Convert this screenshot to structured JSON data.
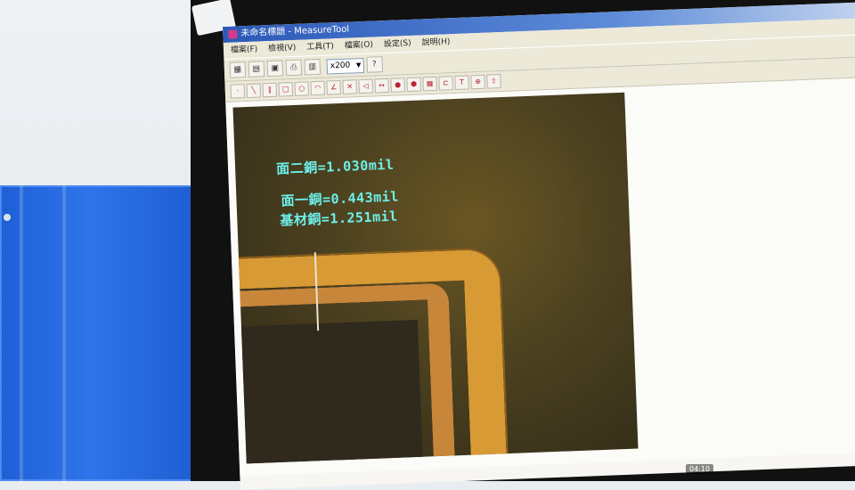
{
  "window": {
    "title": "未命名標題 - MeasureTool"
  },
  "menu": [
    "檔案(F)",
    "檢視(V)",
    "工具(T)",
    "檔案(O)",
    "設定(S)",
    "說明(H)"
  ],
  "toolbar": {
    "zoom": "x200"
  },
  "measurements": [
    "面二銅=1.030mil",
    "面一銅=0.443mil",
    "基材銅=1.251mil"
  ],
  "overlay": {
    "timestamp": "04:10"
  },
  "colors": {
    "label": "#6df0ea",
    "copper": "#d89a34"
  }
}
